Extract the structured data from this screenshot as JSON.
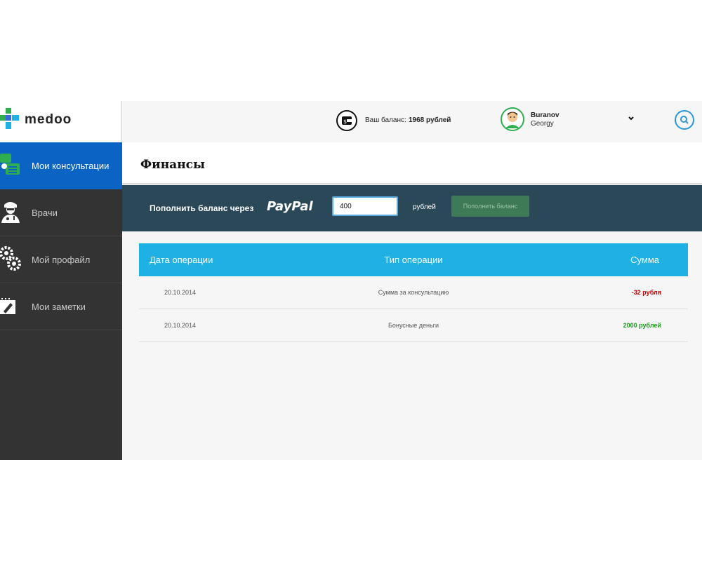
{
  "app": {
    "logo_text": "medoo"
  },
  "sidebar": {
    "items": [
      {
        "label": "Мои консультации",
        "icon": "chat-icon",
        "active": true
      },
      {
        "label": "Врачи",
        "icon": "doctor-icon",
        "active": false
      },
      {
        "label": "Мой профайл",
        "icon": "gears-icon",
        "active": false
      },
      {
        "label": "Мои заметки",
        "icon": "notes-icon",
        "active": false
      }
    ]
  },
  "header": {
    "balance_label": "Ваш баланс:",
    "balance_value": "1968 рублей",
    "user_last_name": "Buranov",
    "user_first_name": "Georgy",
    "icons": {
      "wallet": "wallet-icon",
      "avatar": "avatar",
      "dropdown": "chevron-down-icon",
      "search": "search-icon"
    }
  },
  "page": {
    "title": "Финансы"
  },
  "topup": {
    "label": "Пополнить баланс через",
    "provider": "PayPal",
    "amount_value": "400",
    "currency_label": "рублей",
    "button_label": "Пополнить баланс"
  },
  "table": {
    "headers": [
      "Дата операции",
      "Тип операции",
      "Сумма"
    ],
    "rows": [
      {
        "date": "20.10.2014",
        "type": "Сумма за консультацию",
        "amount": "-32 рубля",
        "sign": "negative"
      },
      {
        "date": "20.10.2014",
        "type": "Бонусные деньги",
        "amount": "2000 рублей",
        "sign": "positive"
      }
    ]
  },
  "colors": {
    "sidebar_bg": "#333333",
    "active_nav": "#0b63c4",
    "paypal_band": "#2b4858",
    "table_header": "#1fb1e3",
    "negative": "#b80000",
    "positive": "#1a9a1a",
    "button": "#3f7a56"
  }
}
